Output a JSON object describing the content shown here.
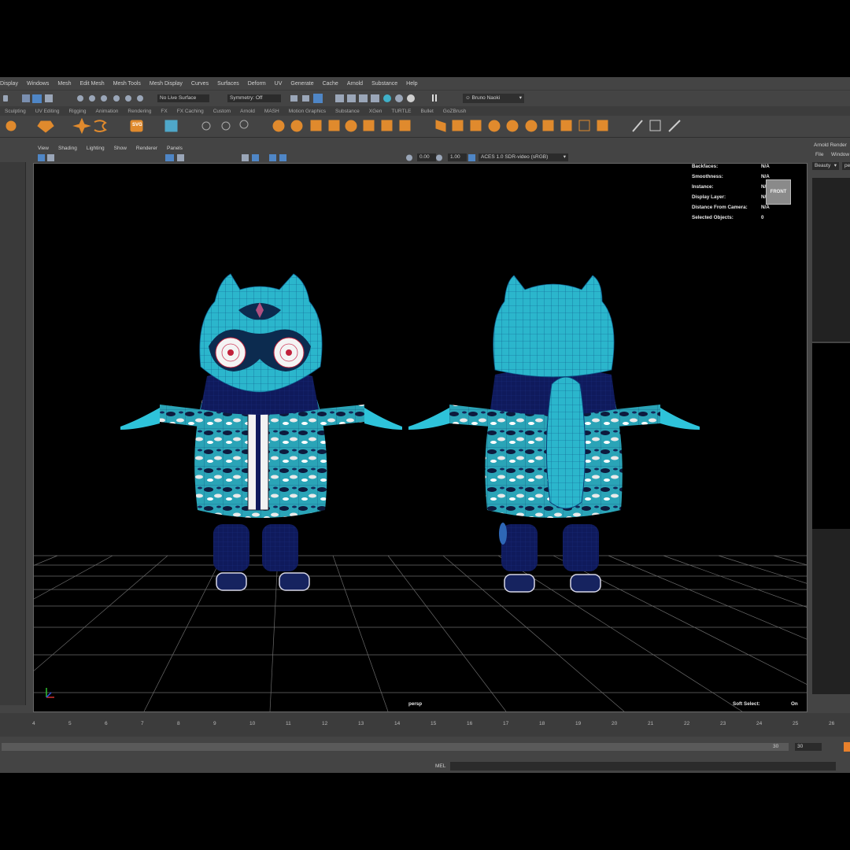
{
  "menubar": {
    "items": [
      "Display",
      "Windows",
      "Mesh",
      "Edit Mesh",
      "Mesh Tools",
      "Mesh Display",
      "Curves",
      "Surfaces",
      "Deform",
      "UV",
      "Generate",
      "Cache",
      "Arnold",
      "Substance",
      "Help"
    ]
  },
  "status_line": {
    "live_surface": "No Live Surface",
    "symmetry": "Symmetry: Off",
    "user": "Bruno Naoki"
  },
  "shelf": {
    "tabs": [
      "Sculpting",
      "UV Editing",
      "Rigging",
      "Animation",
      "Rendering",
      "FX",
      "FX Caching",
      "Custom",
      "Arnold",
      "MASH",
      "Motion Graphics",
      "Substance",
      "XGen",
      "TURTLE",
      "Bullet",
      "GoZBrush"
    ],
    "svg_label": "SVG"
  },
  "panel": {
    "menu": [
      "View",
      "Shading",
      "Lighting",
      "Show",
      "Renderer",
      "Panels"
    ],
    "exposure": "0.00",
    "gamma": "1.00",
    "color_space": "ACES 1.0 SDR-video (sRGB)"
  },
  "hud": {
    "rows": [
      {
        "label": "Backfaces:",
        "value": "N/A"
      },
      {
        "label": "Smoothness:",
        "value": "N/A"
      },
      {
        "label": "Instance:",
        "value": "N/A"
      },
      {
        "label": "Display Layer:",
        "value": "N/A"
      },
      {
        "label": "Distance From Camera:",
        "value": "N/A"
      },
      {
        "label": "Selected Objects:",
        "value": "0"
      }
    ],
    "view_cube": "FRONT",
    "camera": "persp",
    "soft_select_label": "Soft Select:",
    "soft_select_value": "On"
  },
  "right_panel": {
    "title": "Arnold Render",
    "menu_file": "File",
    "menu_window": "Window",
    "beauty": "Beauty",
    "pe": "pe"
  },
  "timeline": {
    "ticks": [
      "4",
      "5",
      "6",
      "7",
      "8",
      "9",
      "10",
      "11",
      "12",
      "13",
      "14",
      "15",
      "16",
      "17",
      "18",
      "19",
      "20",
      "21",
      "22",
      "23",
      "24",
      "25",
      "26"
    ]
  },
  "range": {
    "end": "30",
    "anim_end": "30"
  },
  "cmdline": {
    "label": "MEL"
  },
  "colors": {
    "mesh_cyan": "#29b3c9",
    "pants_navy": "#0f1a5c",
    "viewport_bg": "#000000",
    "accent_orange": "#e8802b"
  }
}
